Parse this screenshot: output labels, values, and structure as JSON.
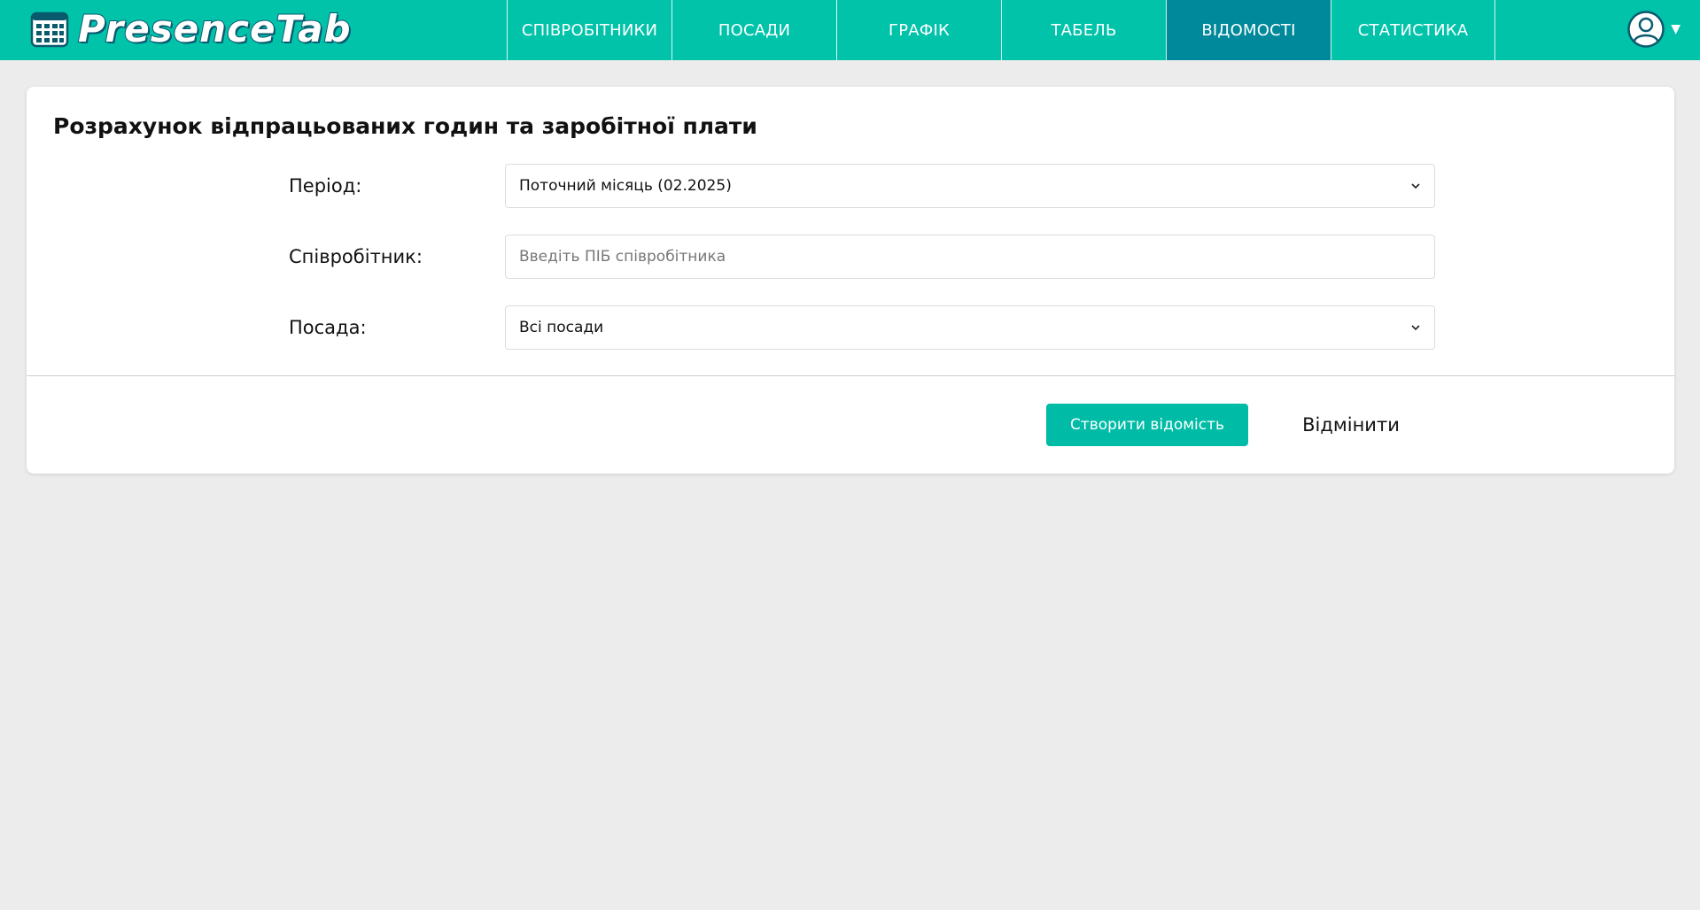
{
  "app": {
    "name": "PresenceTab",
    "logo_icon": "calendar-grid-icon",
    "accent_color": "#00c3aa",
    "active_nav_color": "#00899a"
  },
  "nav": {
    "items": [
      {
        "label": "СПІВРОБІТНИКИ",
        "active": false
      },
      {
        "label": "ПОСАДИ",
        "active": false
      },
      {
        "label": "ГРАФІК",
        "active": false
      },
      {
        "label": "ТАБЕЛЬ",
        "active": false
      },
      {
        "label": "ВІДОМОСТІ",
        "active": true
      },
      {
        "label": "СТАТИСТИКА",
        "active": false
      }
    ]
  },
  "user_menu": {
    "icon": "user-avatar-icon",
    "caret": "▼"
  },
  "form": {
    "title": "Розрахунок відпрацьованих годин та заробітної плати",
    "period": {
      "label": "Період:",
      "value": "Поточний місяць (02.2025)"
    },
    "employee": {
      "label": "Співробітник:",
      "value": "",
      "placeholder": "Введіть ПІБ співробітника"
    },
    "position": {
      "label": "Посада:",
      "value": "Всі посади"
    },
    "submit_label": "Створити відомість",
    "cancel_label": "Відмінити"
  }
}
